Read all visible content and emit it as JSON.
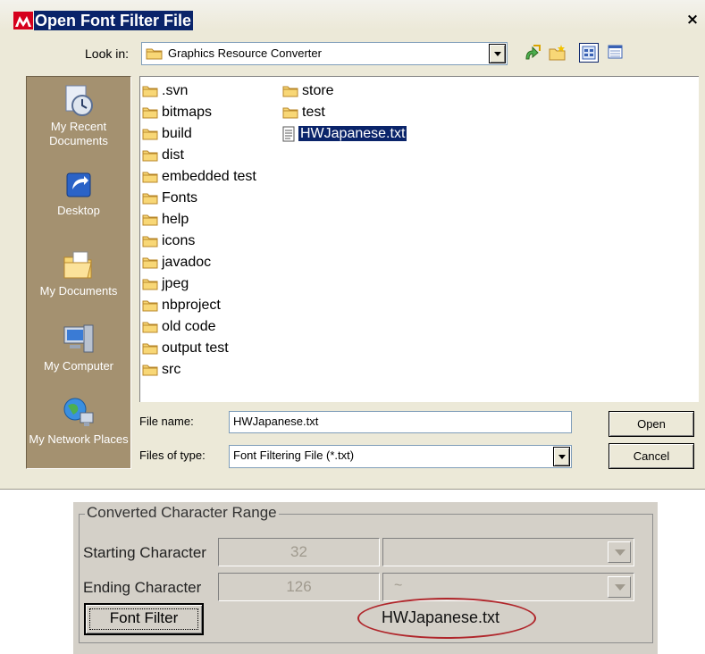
{
  "dialog": {
    "title": "Open Font Filter File",
    "close_glyph": "×",
    "look_in": {
      "label": "Look in:",
      "value": "Graphics Resource Converter"
    },
    "toolbar": {
      "icons": [
        "up-one-level-icon",
        "new-folder-icon",
        "list-view-icon",
        "details-view-icon"
      ]
    },
    "places": [
      {
        "label": "My Recent Documents",
        "icon": "recent-documents-icon"
      },
      {
        "label": "Desktop",
        "icon": "desktop-icon"
      },
      {
        "label": "My Documents",
        "icon": "my-documents-icon"
      },
      {
        "label": "My Computer",
        "icon": "my-computer-icon"
      },
      {
        "label": "My Network Places",
        "icon": "network-places-icon"
      }
    ],
    "files_col1": [
      ".svn",
      "bitmaps",
      "build",
      "dist",
      "embedded test",
      "Fonts",
      "help",
      "icons",
      "javadoc",
      "jpeg",
      "nbproject",
      "old code",
      "output test",
      "src"
    ],
    "files_col2": [
      {
        "name": "store",
        "type": "folder"
      },
      {
        "name": "test",
        "type": "folder"
      },
      {
        "name": "HWJapanese.txt",
        "type": "file",
        "selected": true
      }
    ],
    "file_name": {
      "label": "File name:",
      "value": "HWJapanese.txt"
    },
    "files_of_type": {
      "label": "Files of type:",
      "value": "Font Filtering File (*.txt)"
    },
    "buttons": {
      "open": "Open",
      "cancel": "Cancel"
    }
  },
  "range_panel": {
    "group_title": "Converted Character Range",
    "starting": {
      "label": "Starting Character",
      "value": "32",
      "combo": ""
    },
    "ending": {
      "label": "Ending Character",
      "value": "126",
      "combo": "~"
    },
    "font_filter_button": "Font Filter",
    "font_filter_file": "HWJapanese.txt"
  },
  "colors": {
    "title_highlight": "#0a246a",
    "places_bar": "#a49170",
    "annotation_ellipse": "#b0262b"
  }
}
